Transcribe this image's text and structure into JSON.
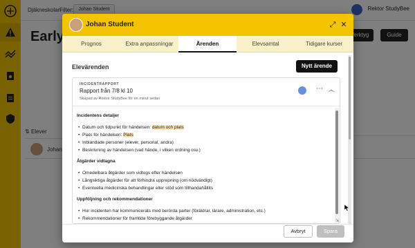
{
  "app": {
    "school": "Djäkneskolan",
    "filter_label": "Filter:",
    "filter_value": "Johan Student",
    "user_name": "Rektor StudyBee",
    "page_title": "Early W",
    "btn_tools": "Verktyg",
    "btn_guide": "Guide",
    "table_header": "Elever",
    "table_row_name": "Johan"
  },
  "modal": {
    "title": "Johan Student",
    "tabs": [
      "Prognos",
      "Extra anpassningar",
      "Ärenden",
      "Elevsamtal",
      "Tidigare kurser"
    ],
    "active_tab": "Ärenden",
    "section_title": "Elevärenden",
    "new_case_button": "Nytt ärende",
    "card": {
      "category": "INCIDENTRAPPORT",
      "title": "Rapport från 7/8 kl 10",
      "subtitle": "Skapad av Rektor StudyBee för en minut sedan"
    },
    "editor": {
      "h1": "Incidentens detaljer",
      "h1_items": [
        "Datum och tidpunkt för händelsen: ",
        "Plats för händelsen: ",
        "Inblandade personer (elever, personal, andra)",
        "Beskrivning av händelsen (vad hände, i vilken ordning osv.)"
      ],
      "h1_highlights": [
        "datum och plats",
        "Plats"
      ],
      "h2": "Åtgärder vidtagna",
      "h2_items": [
        "Omedelbara åtgärder som vidtogs efter händelsen",
        "Långsiktiga åtgärder för att förhindra upprepning (om nödvändigt)",
        "Eventuella medicinska behandlingar eller stöd som tillhandahållits"
      ],
      "h3": "Uppföljning och rekommendationer",
      "h3_items": [
        "Hur incidenten har kommunicerats med berörda parter (föräldrar, lärare, administration, etc.)",
        "Rekommendationer för framtida förebyggande åtgärder"
      ]
    },
    "cancel_button": "Avbryt",
    "save_button": "Spara"
  },
  "colors": {
    "brand_yellow": "#f5c400",
    "tab_bar": "#fbf1c8",
    "highlight": "#fbe3b8",
    "dark_button": "#111111"
  }
}
